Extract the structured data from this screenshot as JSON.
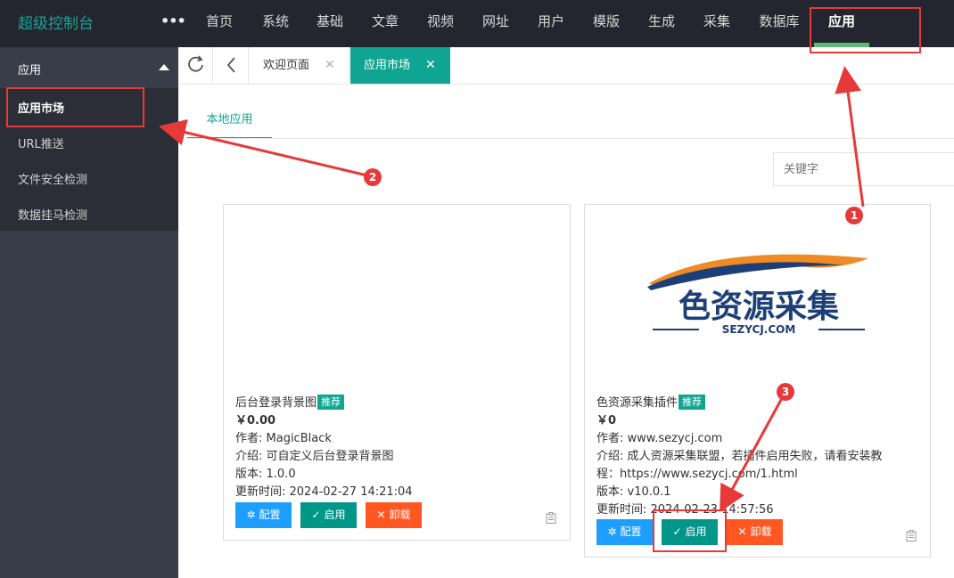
{
  "app": {
    "title": "超级控制台"
  },
  "nav": {
    "more": "•••",
    "items": [
      "首页",
      "系统",
      "基础",
      "文章",
      "视频",
      "网址",
      "用户",
      "模版",
      "生成",
      "采集",
      "数据库",
      "应用"
    ]
  },
  "sidebar": {
    "group": "应用",
    "items": [
      "应用市场",
      "URL推送",
      "文件安全检测",
      "数据挂马检测"
    ]
  },
  "tabs": {
    "welcome": "欢迎页面",
    "market": "应用市场",
    "close": "✕"
  },
  "subtabs": {
    "local": "本地应用"
  },
  "search": {
    "placeholder": "关键字"
  },
  "cards": [
    {
      "name": "后台登录背景图",
      "badge": "推荐",
      "price": "￥0.00",
      "author": "作者: MagicBlack",
      "intro": "介绍: 可自定义后台登录背景图",
      "version": "版本: 1.0.0",
      "updated": "更新时间: 2024-02-27 14:21:04",
      "btn_config": "配置",
      "btn_enable": "启用",
      "btn_uninstall": "卸载"
    },
    {
      "name": "色资源采集插件",
      "badge": "推荐",
      "price": "￥0",
      "author": "作者: www.sezycj.com",
      "intro_line1": "介绍: 成人资源采集联盟，若插件启用失败，请看安装教",
      "intro_line2": "程：https://www.sezycj.com/1.html",
      "version": "版本: v10.0.1",
      "updated": "更新时间: 2024-02-23 14:57:56",
      "btn_config": "配置",
      "btn_enable": "启用",
      "btn_uninstall": "卸载",
      "logo_text": "色资源采集",
      "logo_domain": "SEZYCJ.COM"
    }
  ],
  "annotations": {
    "n1": "1",
    "n2": "2",
    "n3": "3"
  },
  "colors": {
    "accent": "#0fa592",
    "topbar": "#23262e",
    "sidebar": "#393d49",
    "annotation": "#e63a3a"
  }
}
